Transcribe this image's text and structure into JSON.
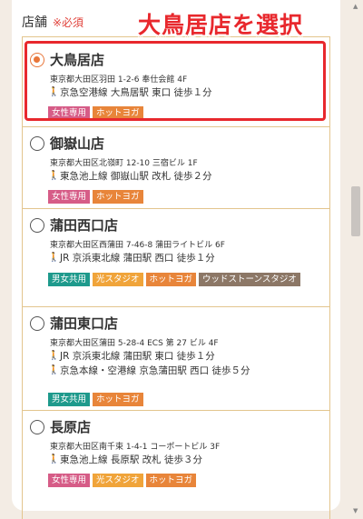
{
  "header": {
    "label": "店舗",
    "required": "※必須"
  },
  "annotation": "大鳥居店を選択",
  "tag_colors": {
    "女性専用": "#d65c87",
    "ホットヨガ": "#e8853a",
    "男女共用": "#1e9a8c",
    "光スタジオ": "#f0a43a",
    "ウッドストーンスタジオ": "#8c7766"
  },
  "stores": [
    {
      "name": "大鳥居店",
      "address": "東京都大田区羽田 1-2-6 奉仕会館 4F",
      "selected": true,
      "access": [
        "京急空港線 大鳥居駅 東口 徒歩１分"
      ],
      "tags": [
        "女性専用",
        "ホットヨガ"
      ]
    },
    {
      "name": "御嶽山店",
      "address": "東京都大田区北嶺町 12-10 三宿ビル 1F",
      "selected": false,
      "access": [
        "東急池上線 御嶽山駅 改札 徒歩２分"
      ],
      "tags": [
        "女性専用",
        "ホットヨガ"
      ]
    },
    {
      "name": "蒲田西口店",
      "address": "東京都大田区西蒲田 7-46-8 蒲田ライトビル 6F",
      "selected": false,
      "access": [
        "JR 京浜東北線 蒲田駅 西口 徒歩１分"
      ],
      "tags": [
        "男女共用",
        "光スタジオ",
        "ホットヨガ",
        "ウッドストーンスタジオ"
      ]
    },
    {
      "name": "蒲田東口店",
      "address": "東京都大田区蒲田 5-28-4 ECS 第 27 ビル 4F",
      "selected": false,
      "access": [
        "JR 京浜東北線 蒲田駅 東口 徒歩１分",
        "京急本線・空港線 京急蒲田駅 西口 徒歩５分"
      ],
      "tags": [
        "男女共用",
        "ホットヨガ"
      ]
    },
    {
      "name": "長原店",
      "address": "東京都大田区南千束 1-4-1 コーポートビル 3F",
      "selected": false,
      "access": [
        "東急池上線 長原駅 改札 徒歩３分"
      ],
      "tags": [
        "女性専用",
        "光スタジオ",
        "ホットヨガ"
      ]
    }
  ]
}
